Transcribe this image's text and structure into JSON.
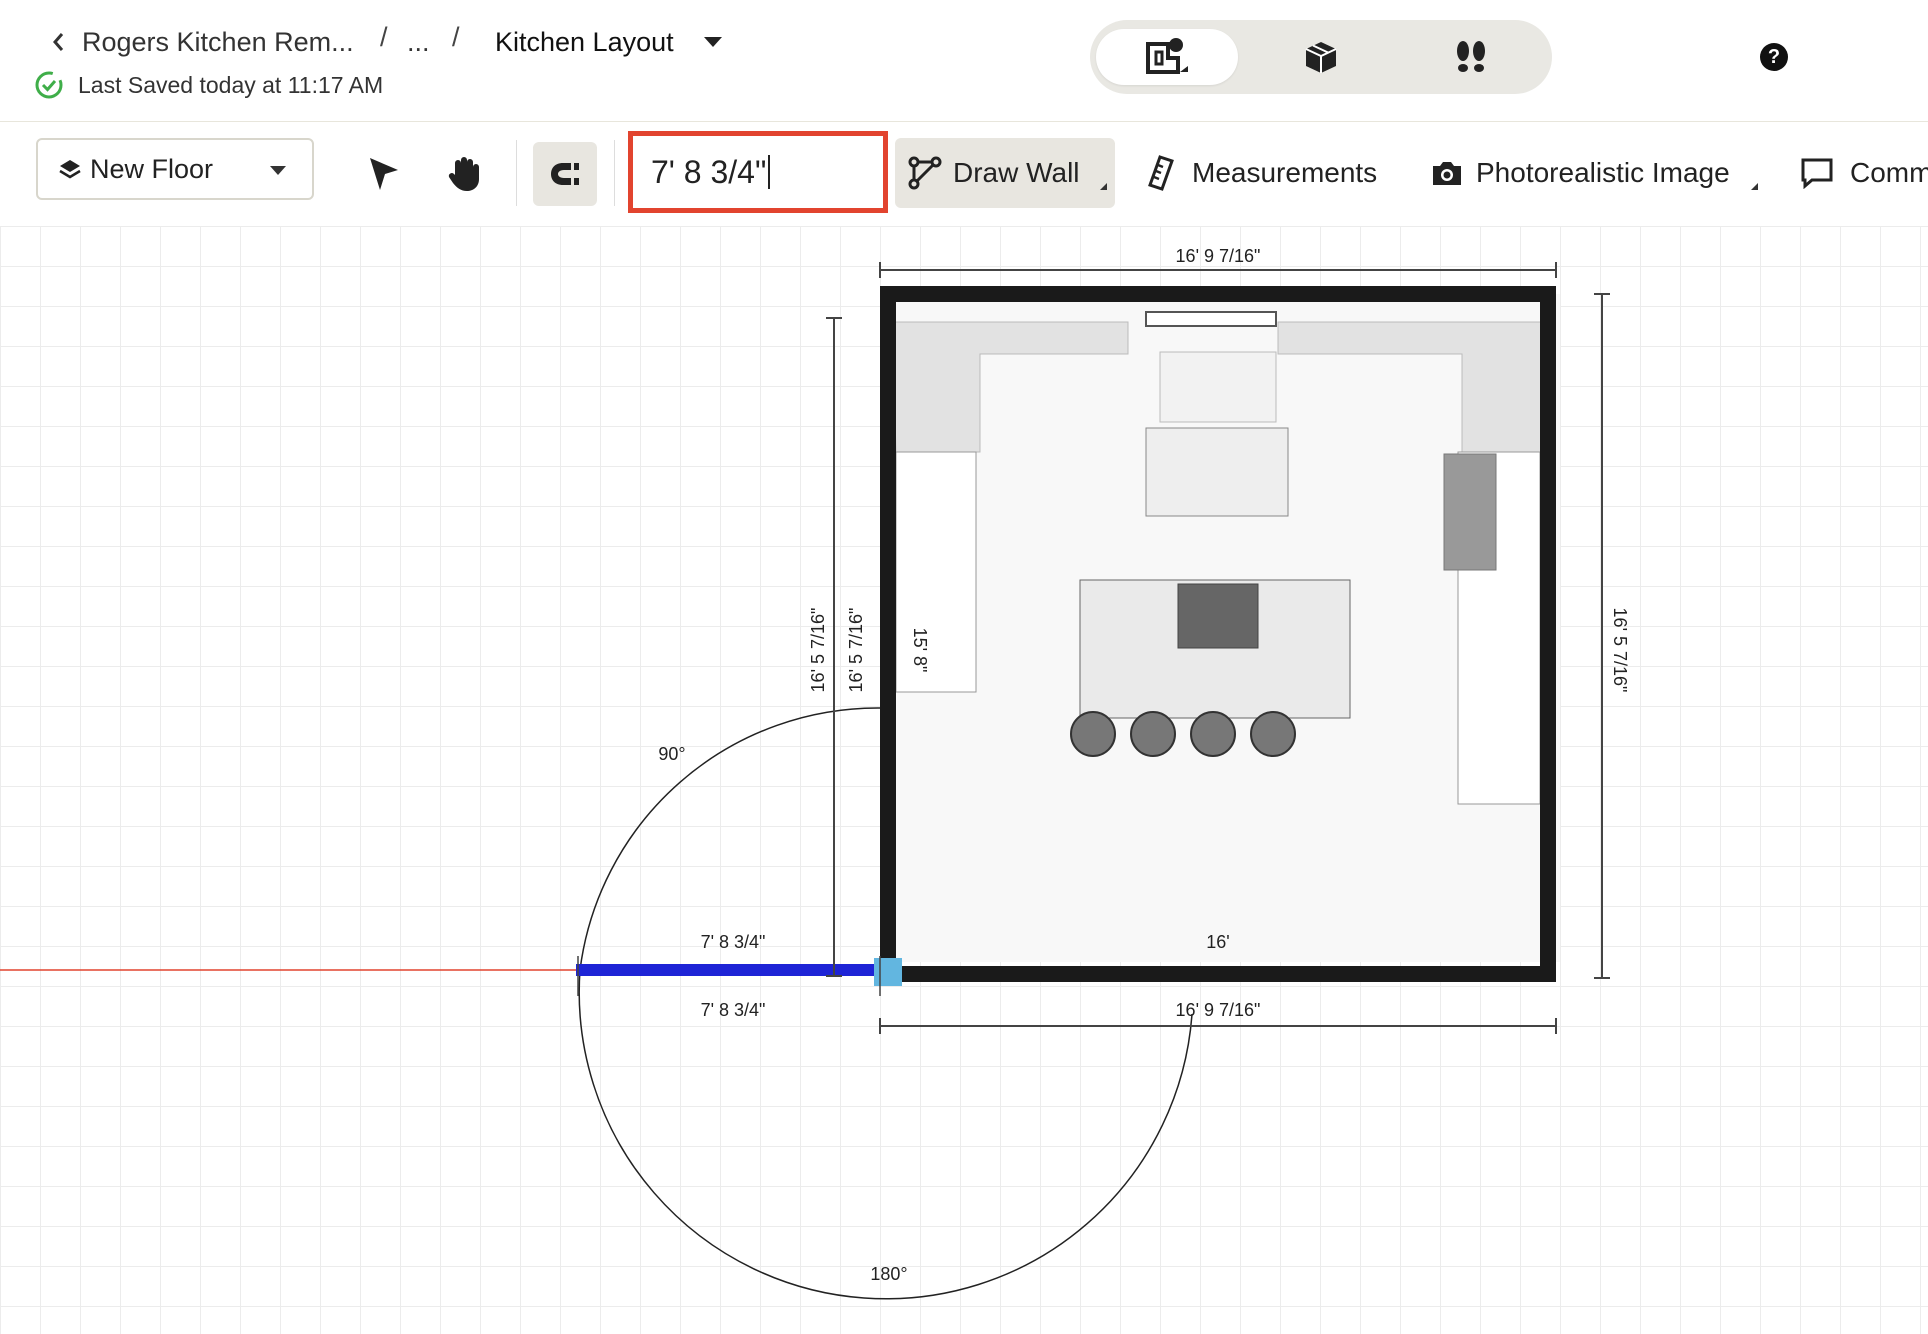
{
  "header": {
    "back_label": "Rogers Kitchen Rem...",
    "separator": "/",
    "ellipsis": "...",
    "page_title": "Kitchen Layout",
    "saved_status": "Last Saved today at 11:17 AM",
    "help_label": "?"
  },
  "view_modes": [
    {
      "icon": "2d-floorplan-icon",
      "active": true
    },
    {
      "icon": "3d-box-icon",
      "active": false
    },
    {
      "icon": "footsteps-icon",
      "active": false
    }
  ],
  "toolbar": {
    "floor_label": "New Floor",
    "length_input_value": "7' 8 3/4\"",
    "draw_wall_label": "Draw Wall",
    "measurements_label": "Measurements",
    "photo_label": "Photorealistic Image",
    "comments_label": "Comm"
  },
  "plan": {
    "top_dimension": "16' 9 7/16\"",
    "bottom_dimension": "16' 9 7/16\"",
    "right_dimension": "16' 5 7/16\"",
    "left_outer_dimension": "16' 5 7/16\"",
    "left_inner_dimension": "16' 5 7/16\"",
    "counter_dimension": "15' 8\"",
    "new_wall_top": "7' 8 3/4\"",
    "new_wall_bottom": "7' 8 3/4\"",
    "bottom_inner_dimension": "16'",
    "angle_90": "90°",
    "angle_180": "180°"
  },
  "colors": {
    "accent_red": "#e2442f",
    "wall": "#1a1a1a",
    "new_wall": "#1e24d6",
    "saved_green": "#3fae49"
  }
}
